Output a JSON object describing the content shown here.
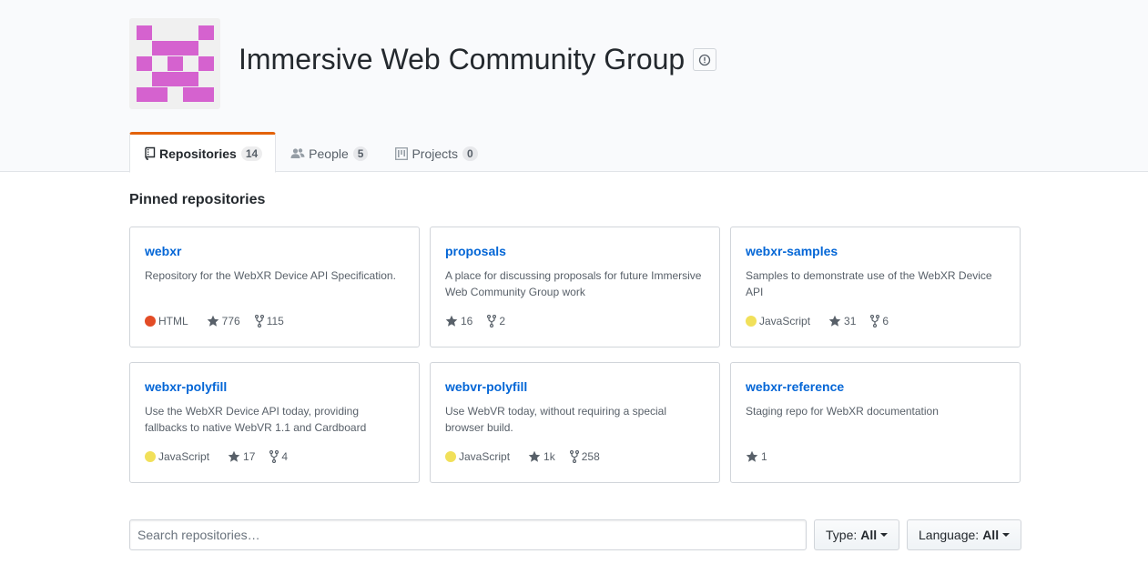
{
  "org": {
    "name": "Immersive Web Community Group",
    "avatar_color": "#d562cf"
  },
  "tabs": [
    {
      "label": "Repositories",
      "count": "14",
      "icon": "repo-icon",
      "selected": true
    },
    {
      "label": "People",
      "count": "5",
      "icon": "people-icon",
      "selected": false
    },
    {
      "label": "Projects",
      "count": "0",
      "icon": "project-icon",
      "selected": false
    }
  ],
  "pinned": {
    "title": "Pinned repositories",
    "repos": [
      {
        "name": "webxr",
        "description": "Repository for the WebXR Device API Specification.",
        "language": "HTML",
        "language_color": "#e34c26",
        "stars": "776",
        "forks": "115"
      },
      {
        "name": "proposals",
        "description": "A place for discussing proposals for future Immersive Web Community Group work",
        "language": "",
        "language_color": "",
        "stars": "16",
        "forks": "2"
      },
      {
        "name": "webxr-samples",
        "description": "Samples to demonstrate use of the WebXR Device API",
        "language": "JavaScript",
        "language_color": "#f1e05a",
        "stars": "31",
        "forks": "6"
      },
      {
        "name": "webxr-polyfill",
        "description": "Use the WebXR Device API today, providing fallbacks to native WebVR 1.1 and Cardboard",
        "language": "JavaScript",
        "language_color": "#f1e05a",
        "stars": "17",
        "forks": "4"
      },
      {
        "name": "webvr-polyfill",
        "description": "Use WebVR today, without requiring a special browser build.",
        "language": "JavaScript",
        "language_color": "#f1e05a",
        "stars": "1k",
        "forks": "258"
      },
      {
        "name": "webxr-reference",
        "description": "Staging repo for WebXR documentation",
        "language": "",
        "language_color": "",
        "stars": "1",
        "forks": ""
      }
    ]
  },
  "filters": {
    "search_placeholder": "Search repositories…",
    "type_label": "Type:",
    "type_value": "All",
    "language_label": "Language:",
    "language_value": "All"
  },
  "colors": {
    "accent_tab": "#e36209",
    "link": "#0366d6"
  }
}
